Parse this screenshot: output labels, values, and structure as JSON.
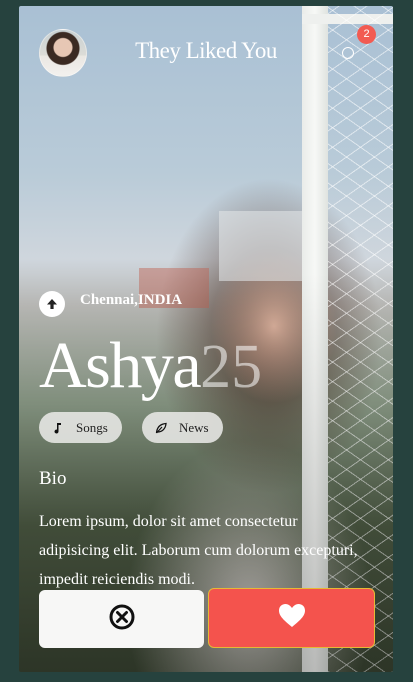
{
  "header": {
    "title": "They Liked You",
    "notification_count": "2"
  },
  "profile": {
    "location": "Chennai,INDIA",
    "name": "Ashya",
    "age": "25"
  },
  "chips": [
    {
      "label": "Songs",
      "icon": "music-note-icon"
    },
    {
      "label": "News",
      "icon": "leaf-icon"
    }
  ],
  "bio": {
    "heading": "Bio",
    "text": "Lorem ipsum, dolor sit amet consectetur adipisicing elit. Laborum cum dolorum excepturi, impedit reiciendis modi."
  },
  "actions": {
    "reject_icon": "close-circle-icon",
    "like_icon": "heart-icon"
  },
  "colors": {
    "background": "#26423e",
    "like": "#f4534d",
    "badge": "#f25b52"
  }
}
